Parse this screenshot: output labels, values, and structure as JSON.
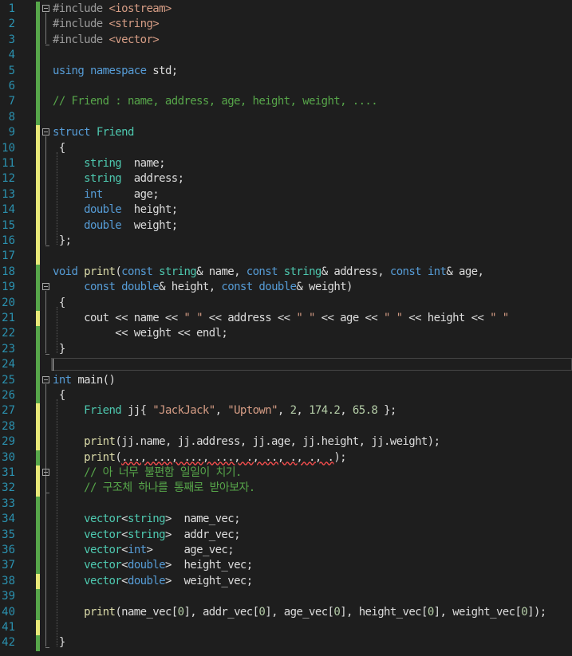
{
  "editor": {
    "lines": [
      {
        "n": "1",
        "fold": true,
        "change": "saved",
        "tokens": [
          {
            "t": "#include ",
            "c": "p"
          },
          {
            "t": "<iostream>",
            "c": "s"
          }
        ]
      },
      {
        "n": "2",
        "change": "saved",
        "tokens": [
          {
            "t": "#include ",
            "c": "p"
          },
          {
            "t": "<string>",
            "c": "s"
          }
        ]
      },
      {
        "n": "3",
        "change": "saved",
        "tokens": [
          {
            "t": "#include ",
            "c": "p"
          },
          {
            "t": "<vector>",
            "c": "s"
          }
        ]
      },
      {
        "n": "4",
        "change": "saved",
        "tokens": []
      },
      {
        "n": "5",
        "change": "saved",
        "tokens": [
          {
            "t": "using ",
            "c": "k"
          },
          {
            "t": "namespace ",
            "c": "k"
          },
          {
            "t": "std;",
            "c": ""
          }
        ]
      },
      {
        "n": "6",
        "change": "saved",
        "tokens": []
      },
      {
        "n": "7",
        "change": "saved",
        "tokens": [
          {
            "t": "// Friend : name, address, age, height, weight, ....",
            "c": "c"
          }
        ]
      },
      {
        "n": "8",
        "change": "saved",
        "tokens": []
      },
      {
        "n": "9",
        "fold": true,
        "change": "unsaved",
        "tokens": [
          {
            "t": "struct ",
            "c": "k"
          },
          {
            "t": "Friend",
            "c": "t"
          }
        ]
      },
      {
        "n": "10",
        "change": "unsaved",
        "tokens": [
          {
            "t": " {",
            "c": ""
          }
        ]
      },
      {
        "n": "11",
        "change": "unsaved",
        "tokens": [
          {
            "t": "     ",
            "c": ""
          },
          {
            "t": "string",
            "c": "t"
          },
          {
            "t": "  name;",
            "c": ""
          }
        ]
      },
      {
        "n": "12",
        "change": "unsaved",
        "tokens": [
          {
            "t": "     ",
            "c": ""
          },
          {
            "t": "string",
            "c": "t"
          },
          {
            "t": "  address;",
            "c": ""
          }
        ]
      },
      {
        "n": "13",
        "change": "unsaved",
        "tokens": [
          {
            "t": "     ",
            "c": ""
          },
          {
            "t": "int",
            "c": "k"
          },
          {
            "t": "     age;",
            "c": ""
          }
        ]
      },
      {
        "n": "14",
        "change": "unsaved",
        "tokens": [
          {
            "t": "     ",
            "c": ""
          },
          {
            "t": "double",
            "c": "k"
          },
          {
            "t": "  height;",
            "c": ""
          }
        ]
      },
      {
        "n": "15",
        "change": "unsaved",
        "tokens": [
          {
            "t": "     ",
            "c": ""
          },
          {
            "t": "double",
            "c": "k"
          },
          {
            "t": "  weight;",
            "c": ""
          }
        ]
      },
      {
        "n": "16",
        "change": "unsaved",
        "tokens": [
          {
            "t": " };",
            "c": ""
          }
        ]
      },
      {
        "n": "17",
        "change": "unsaved",
        "tokens": []
      },
      {
        "n": "18",
        "change": "saved",
        "tokens": [
          {
            "t": "void ",
            "c": "k"
          },
          {
            "t": "print",
            "c": "f"
          },
          {
            "t": "(",
            "c": ""
          },
          {
            "t": "const ",
            "c": "k"
          },
          {
            "t": "string",
            "c": "t"
          },
          {
            "t": "& name, ",
            "c": ""
          },
          {
            "t": "const ",
            "c": "k"
          },
          {
            "t": "string",
            "c": "t"
          },
          {
            "t": "& address, ",
            "c": ""
          },
          {
            "t": "const ",
            "c": "k"
          },
          {
            "t": "int",
            "c": "k"
          },
          {
            "t": "& age,",
            "c": ""
          }
        ]
      },
      {
        "n": "19",
        "fold": true,
        "change": "saved",
        "tokens": [
          {
            "t": "     ",
            "c": ""
          },
          {
            "t": "const ",
            "c": "k"
          },
          {
            "t": "double",
            "c": "k"
          },
          {
            "t": "& height, ",
            "c": ""
          },
          {
            "t": "const ",
            "c": "k"
          },
          {
            "t": "double",
            "c": "k"
          },
          {
            "t": "& weight)",
            "c": ""
          }
        ]
      },
      {
        "n": "20",
        "change": "saved",
        "tokens": [
          {
            "t": " {",
            "c": ""
          }
        ]
      },
      {
        "n": "21",
        "change": "unsaved",
        "tokens": [
          {
            "t": "     cout << name << ",
            "c": ""
          },
          {
            "t": "\" \"",
            "c": "s"
          },
          {
            "t": " << address << ",
            "c": ""
          },
          {
            "t": "\" \"",
            "c": "s"
          },
          {
            "t": " << age << ",
            "c": ""
          },
          {
            "t": "\" \"",
            "c": "s"
          },
          {
            "t": " << height << ",
            "c": ""
          },
          {
            "t": "\" \"",
            "c": "s"
          }
        ]
      },
      {
        "n": "22",
        "change": "saved",
        "tokens": [
          {
            "t": "          << weight << endl;",
            "c": ""
          }
        ]
      },
      {
        "n": "23",
        "change": "saved",
        "tokens": [
          {
            "t": " }",
            "c": ""
          }
        ]
      },
      {
        "n": "24",
        "change": "saved",
        "tokens": []
      },
      {
        "n": "25",
        "fold": true,
        "change": "saved",
        "tokens": [
          {
            "t": "int ",
            "c": "k"
          },
          {
            "t": "main()",
            "c": ""
          }
        ]
      },
      {
        "n": "26",
        "change": "saved",
        "tokens": [
          {
            "t": " {",
            "c": ""
          }
        ]
      },
      {
        "n": "27",
        "change": "unsaved",
        "tokens": [
          {
            "t": "     ",
            "c": ""
          },
          {
            "t": "Friend",
            "c": "t"
          },
          {
            "t": " jj{ ",
            "c": ""
          },
          {
            "t": "\"JackJack\"",
            "c": "s"
          },
          {
            "t": ", ",
            "c": ""
          },
          {
            "t": "\"Uptown\"",
            "c": "s"
          },
          {
            "t": ", ",
            "c": ""
          },
          {
            "t": "2",
            "c": "n"
          },
          {
            "t": ", ",
            "c": ""
          },
          {
            "t": "174.2",
            "c": "n"
          },
          {
            "t": ", ",
            "c": ""
          },
          {
            "t": "65.8",
            "c": "n"
          },
          {
            "t": " };",
            "c": ""
          }
        ]
      },
      {
        "n": "28",
        "change": "unsaved",
        "tokens": []
      },
      {
        "n": "29",
        "change": "unsaved",
        "tokens": [
          {
            "t": "     ",
            "c": ""
          },
          {
            "t": "print",
            "c": "f"
          },
          {
            "t": "(jj.name, jj.address, jj.age, jj.height, jj.weight);",
            "c": ""
          }
        ]
      },
      {
        "n": "30",
        "change": "saved",
        "tokens": [
          {
            "t": "     ",
            "c": ""
          },
          {
            "t": "print",
            "c": "f"
          },
          {
            "t": "(",
            "c": ""
          },
          {
            "t": "..., ..., ..., ..., ., .., ., ., .",
            "c": "sq"
          },
          {
            "t": ");",
            "c": ""
          }
        ]
      },
      {
        "n": "31",
        "fold": true,
        "change": "unsaved",
        "tokens": [
          {
            "t": "     ",
            "c": ""
          },
          {
            "t": "// 아 너무 불편함 일일이 치기.",
            "c": "c"
          }
        ]
      },
      {
        "n": "32",
        "change": "unsaved",
        "tokens": [
          {
            "t": "     ",
            "c": ""
          },
          {
            "t": "// 구조체 하나를 통째로 받아보자.",
            "c": "c"
          }
        ]
      },
      {
        "n": "33",
        "change": "saved",
        "tokens": []
      },
      {
        "n": "34",
        "change": "saved",
        "tokens": [
          {
            "t": "     ",
            "c": ""
          },
          {
            "t": "vector",
            "c": "t"
          },
          {
            "t": "<",
            "c": ""
          },
          {
            "t": "string",
            "c": "t"
          },
          {
            "t": ">  name_vec;",
            "c": ""
          }
        ]
      },
      {
        "n": "35",
        "change": "saved",
        "tokens": [
          {
            "t": "     ",
            "c": ""
          },
          {
            "t": "vector",
            "c": "t"
          },
          {
            "t": "<",
            "c": ""
          },
          {
            "t": "string",
            "c": "t"
          },
          {
            "t": ">  addr_vec;",
            "c": ""
          }
        ]
      },
      {
        "n": "36",
        "change": "saved",
        "tokens": [
          {
            "t": "     ",
            "c": ""
          },
          {
            "t": "vector",
            "c": "t"
          },
          {
            "t": "<",
            "c": ""
          },
          {
            "t": "int",
            "c": "k"
          },
          {
            "t": ">     age_vec;",
            "c": ""
          }
        ]
      },
      {
        "n": "37",
        "change": "saved",
        "tokens": [
          {
            "t": "     ",
            "c": ""
          },
          {
            "t": "vector",
            "c": "t"
          },
          {
            "t": "<",
            "c": ""
          },
          {
            "t": "double",
            "c": "k"
          },
          {
            "t": ">  height_vec;",
            "c": ""
          }
        ]
      },
      {
        "n": "38",
        "change": "unsaved",
        "tokens": [
          {
            "t": "     ",
            "c": ""
          },
          {
            "t": "vector",
            "c": "t"
          },
          {
            "t": "<",
            "c": ""
          },
          {
            "t": "double",
            "c": "k"
          },
          {
            "t": ">  weight_vec;",
            "c": ""
          }
        ]
      },
      {
        "n": "39",
        "change": "saved",
        "tokens": []
      },
      {
        "n": "40",
        "change": "saved",
        "tokens": [
          {
            "t": "     ",
            "c": ""
          },
          {
            "t": "print",
            "c": "f"
          },
          {
            "t": "(name_vec[",
            "c": ""
          },
          {
            "t": "0",
            "c": "n"
          },
          {
            "t": "], addr_vec[",
            "c": ""
          },
          {
            "t": "0",
            "c": "n"
          },
          {
            "t": "], age_vec[",
            "c": ""
          },
          {
            "t": "0",
            "c": "n"
          },
          {
            "t": "], height_vec[",
            "c": ""
          },
          {
            "t": "0",
            "c": "n"
          },
          {
            "t": "], weight_vec[",
            "c": ""
          },
          {
            "t": "0",
            "c": "n"
          },
          {
            "t": "]);",
            "c": ""
          }
        ]
      },
      {
        "n": "41",
        "change": "unsaved",
        "tokens": []
      },
      {
        "n": "42",
        "change": "saved",
        "tokens": [
          {
            "t": " }",
            "c": ""
          }
        ]
      }
    ]
  }
}
